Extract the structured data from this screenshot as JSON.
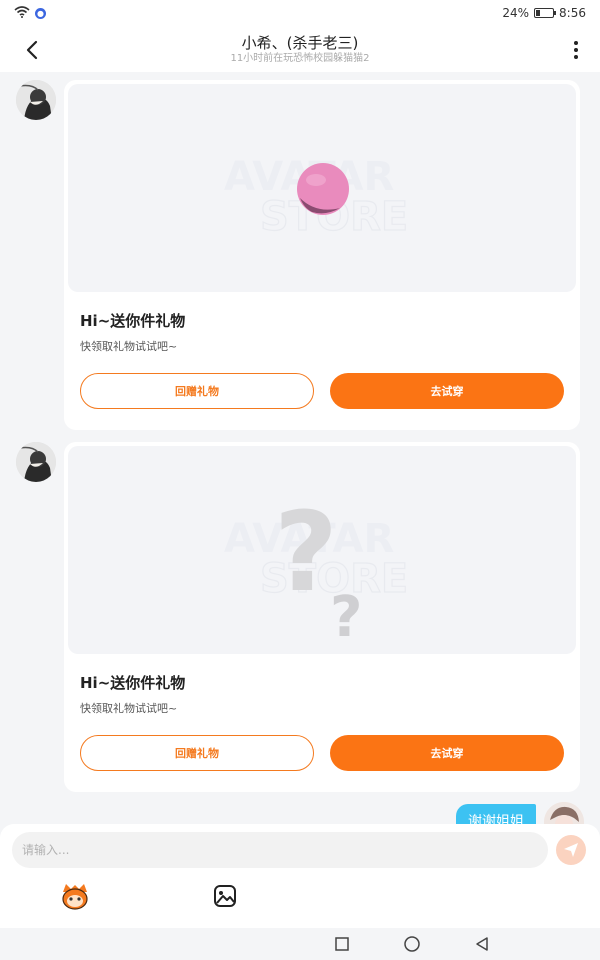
{
  "status_bar": {
    "battery_text": "24%",
    "battery_level": 0.24,
    "time": "8:56",
    "icons": [
      "wifi-icon",
      "app-badge-icon",
      "battery-icon"
    ]
  },
  "header": {
    "title": "小希、(杀手老三)",
    "subtitle": "11小时前在玩恐怖校园躲猫猫2",
    "icons": [
      "back-arrow-icon",
      "more-vertical-icon"
    ]
  },
  "messages": [
    {
      "type": "gift",
      "gift_image": "pink-ball",
      "title": "Hi~送你件礼物",
      "description": "快领取礼物试试吧~",
      "return_label": "回赠礼物",
      "try_label": "去试穿"
    },
    {
      "type": "gift",
      "gift_image": "question-mark",
      "title": "Hi~送你件礼物",
      "description": "快领取礼物试试吧~",
      "return_label": "回赠礼物",
      "try_label": "去试穿"
    },
    {
      "type": "text",
      "direction": "outgoing",
      "text": "谢谢姐姐"
    }
  ],
  "watermark": {
    "line1": "AVATAR",
    "line2": "STORE"
  },
  "input": {
    "placeholder": "请输入..."
  },
  "toolbar": {
    "icons": [
      "mascot-emoji-icon",
      "image-picker-icon",
      "send-icon"
    ]
  },
  "colors": {
    "accent": "#fb7414",
    "bubble": "#3cc2f2",
    "send_disabled": "#fbd3c0",
    "background": "#f4f5f7"
  }
}
